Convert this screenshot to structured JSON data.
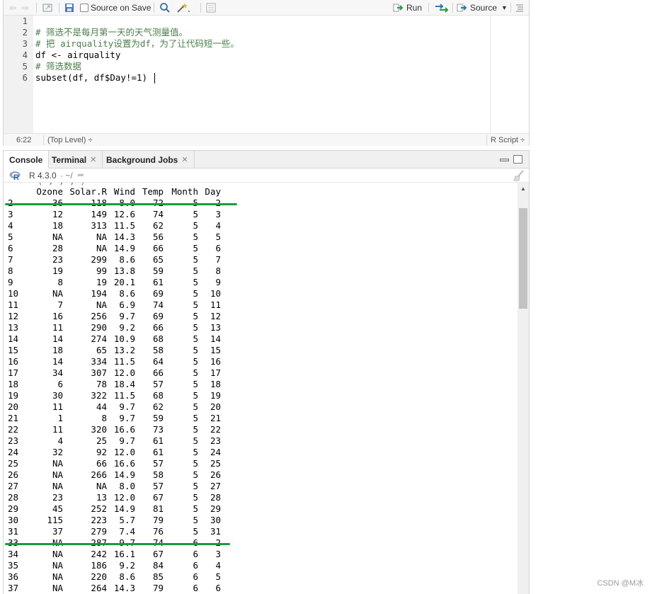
{
  "editor": {
    "toolbar": {
      "source_on_save": "Source on Save",
      "run": "Run",
      "source": "Source"
    },
    "line_numbers": [
      "1",
      "2",
      "3",
      "4",
      "5",
      "6"
    ],
    "lines": [
      "",
      "# 筛选不是每月第一天的天气测量值。",
      "# 把 airquality设置为df，为了让代码短一些。",
      "df <- airquality",
      "# 筛选数据",
      "subset(df, df$Day!=1)"
    ],
    "status": {
      "position": "6:22",
      "scope": "(Top Level) ÷",
      "filetype": "R Script ÷"
    }
  },
  "console": {
    "tabs": [
      "Console",
      "Terminal",
      "Background Jobs"
    ],
    "version": "R 4.3.0",
    "path": "· ~/",
    "header": [
      "",
      "Ozone",
      "Solar.R",
      "Wind",
      "Temp",
      "Month",
      "Day"
    ],
    "rows": [
      [
        "2",
        "36",
        "118",
        "8.0",
        "72",
        "5",
        "2"
      ],
      [
        "3",
        "12",
        "149",
        "12.6",
        "74",
        "5",
        "3"
      ],
      [
        "4",
        "18",
        "313",
        "11.5",
        "62",
        "5",
        "4"
      ],
      [
        "5",
        "NA",
        "NA",
        "14.3",
        "56",
        "5",
        "5"
      ],
      [
        "6",
        "28",
        "NA",
        "14.9",
        "66",
        "5",
        "6"
      ],
      [
        "7",
        "23",
        "299",
        "8.6",
        "65",
        "5",
        "7"
      ],
      [
        "8",
        "19",
        "99",
        "13.8",
        "59",
        "5",
        "8"
      ],
      [
        "9",
        "8",
        "19",
        "20.1",
        "61",
        "5",
        "9"
      ],
      [
        "10",
        "NA",
        "194",
        "8.6",
        "69",
        "5",
        "10"
      ],
      [
        "11",
        "7",
        "NA",
        "6.9",
        "74",
        "5",
        "11"
      ],
      [
        "12",
        "16",
        "256",
        "9.7",
        "69",
        "5",
        "12"
      ],
      [
        "13",
        "11",
        "290",
        "9.2",
        "66",
        "5",
        "13"
      ],
      [
        "14",
        "14",
        "274",
        "10.9",
        "68",
        "5",
        "14"
      ],
      [
        "15",
        "18",
        "65",
        "13.2",
        "58",
        "5",
        "15"
      ],
      [
        "16",
        "14",
        "334",
        "11.5",
        "64",
        "5",
        "16"
      ],
      [
        "17",
        "34",
        "307",
        "12.0",
        "66",
        "5",
        "17"
      ],
      [
        "18",
        "6",
        "78",
        "18.4",
        "57",
        "5",
        "18"
      ],
      [
        "19",
        "30",
        "322",
        "11.5",
        "68",
        "5",
        "19"
      ],
      [
        "20",
        "11",
        "44",
        "9.7",
        "62",
        "5",
        "20"
      ],
      [
        "21",
        "1",
        "8",
        "9.7",
        "59",
        "5",
        "21"
      ],
      [
        "22",
        "11",
        "320",
        "16.6",
        "73",
        "5",
        "22"
      ],
      [
        "23",
        "4",
        "25",
        "9.7",
        "61",
        "5",
        "23"
      ],
      [
        "24",
        "32",
        "92",
        "12.0",
        "61",
        "5",
        "24"
      ],
      [
        "25",
        "NA",
        "66",
        "16.6",
        "57",
        "5",
        "25"
      ],
      [
        "26",
        "NA",
        "266",
        "14.9",
        "58",
        "5",
        "26"
      ],
      [
        "27",
        "NA",
        "NA",
        "8.0",
        "57",
        "5",
        "27"
      ],
      [
        "28",
        "23",
        "13",
        "12.0",
        "67",
        "5",
        "28"
      ],
      [
        "29",
        "45",
        "252",
        "14.9",
        "81",
        "5",
        "29"
      ],
      [
        "30",
        "115",
        "223",
        "5.7",
        "79",
        "5",
        "30"
      ],
      [
        "31",
        "37",
        "279",
        "7.4",
        "76",
        "5",
        "31"
      ],
      [
        "33",
        "NA",
        "287",
        "9.7",
        "74",
        "6",
        "2"
      ],
      [
        "34",
        "NA",
        "242",
        "16.1",
        "67",
        "6",
        "3"
      ],
      [
        "35",
        "NA",
        "186",
        "9.2",
        "84",
        "6",
        "4"
      ],
      [
        "36",
        "NA",
        "220",
        "8.6",
        "85",
        "6",
        "5"
      ],
      [
        "37",
        "NA",
        "264",
        "14.3",
        "79",
        "6",
        "6"
      ]
    ]
  },
  "watermark": "CSDN @M冰",
  "colors": {
    "highlight": "#1a9c3a",
    "comment": "#4a7f4a"
  }
}
